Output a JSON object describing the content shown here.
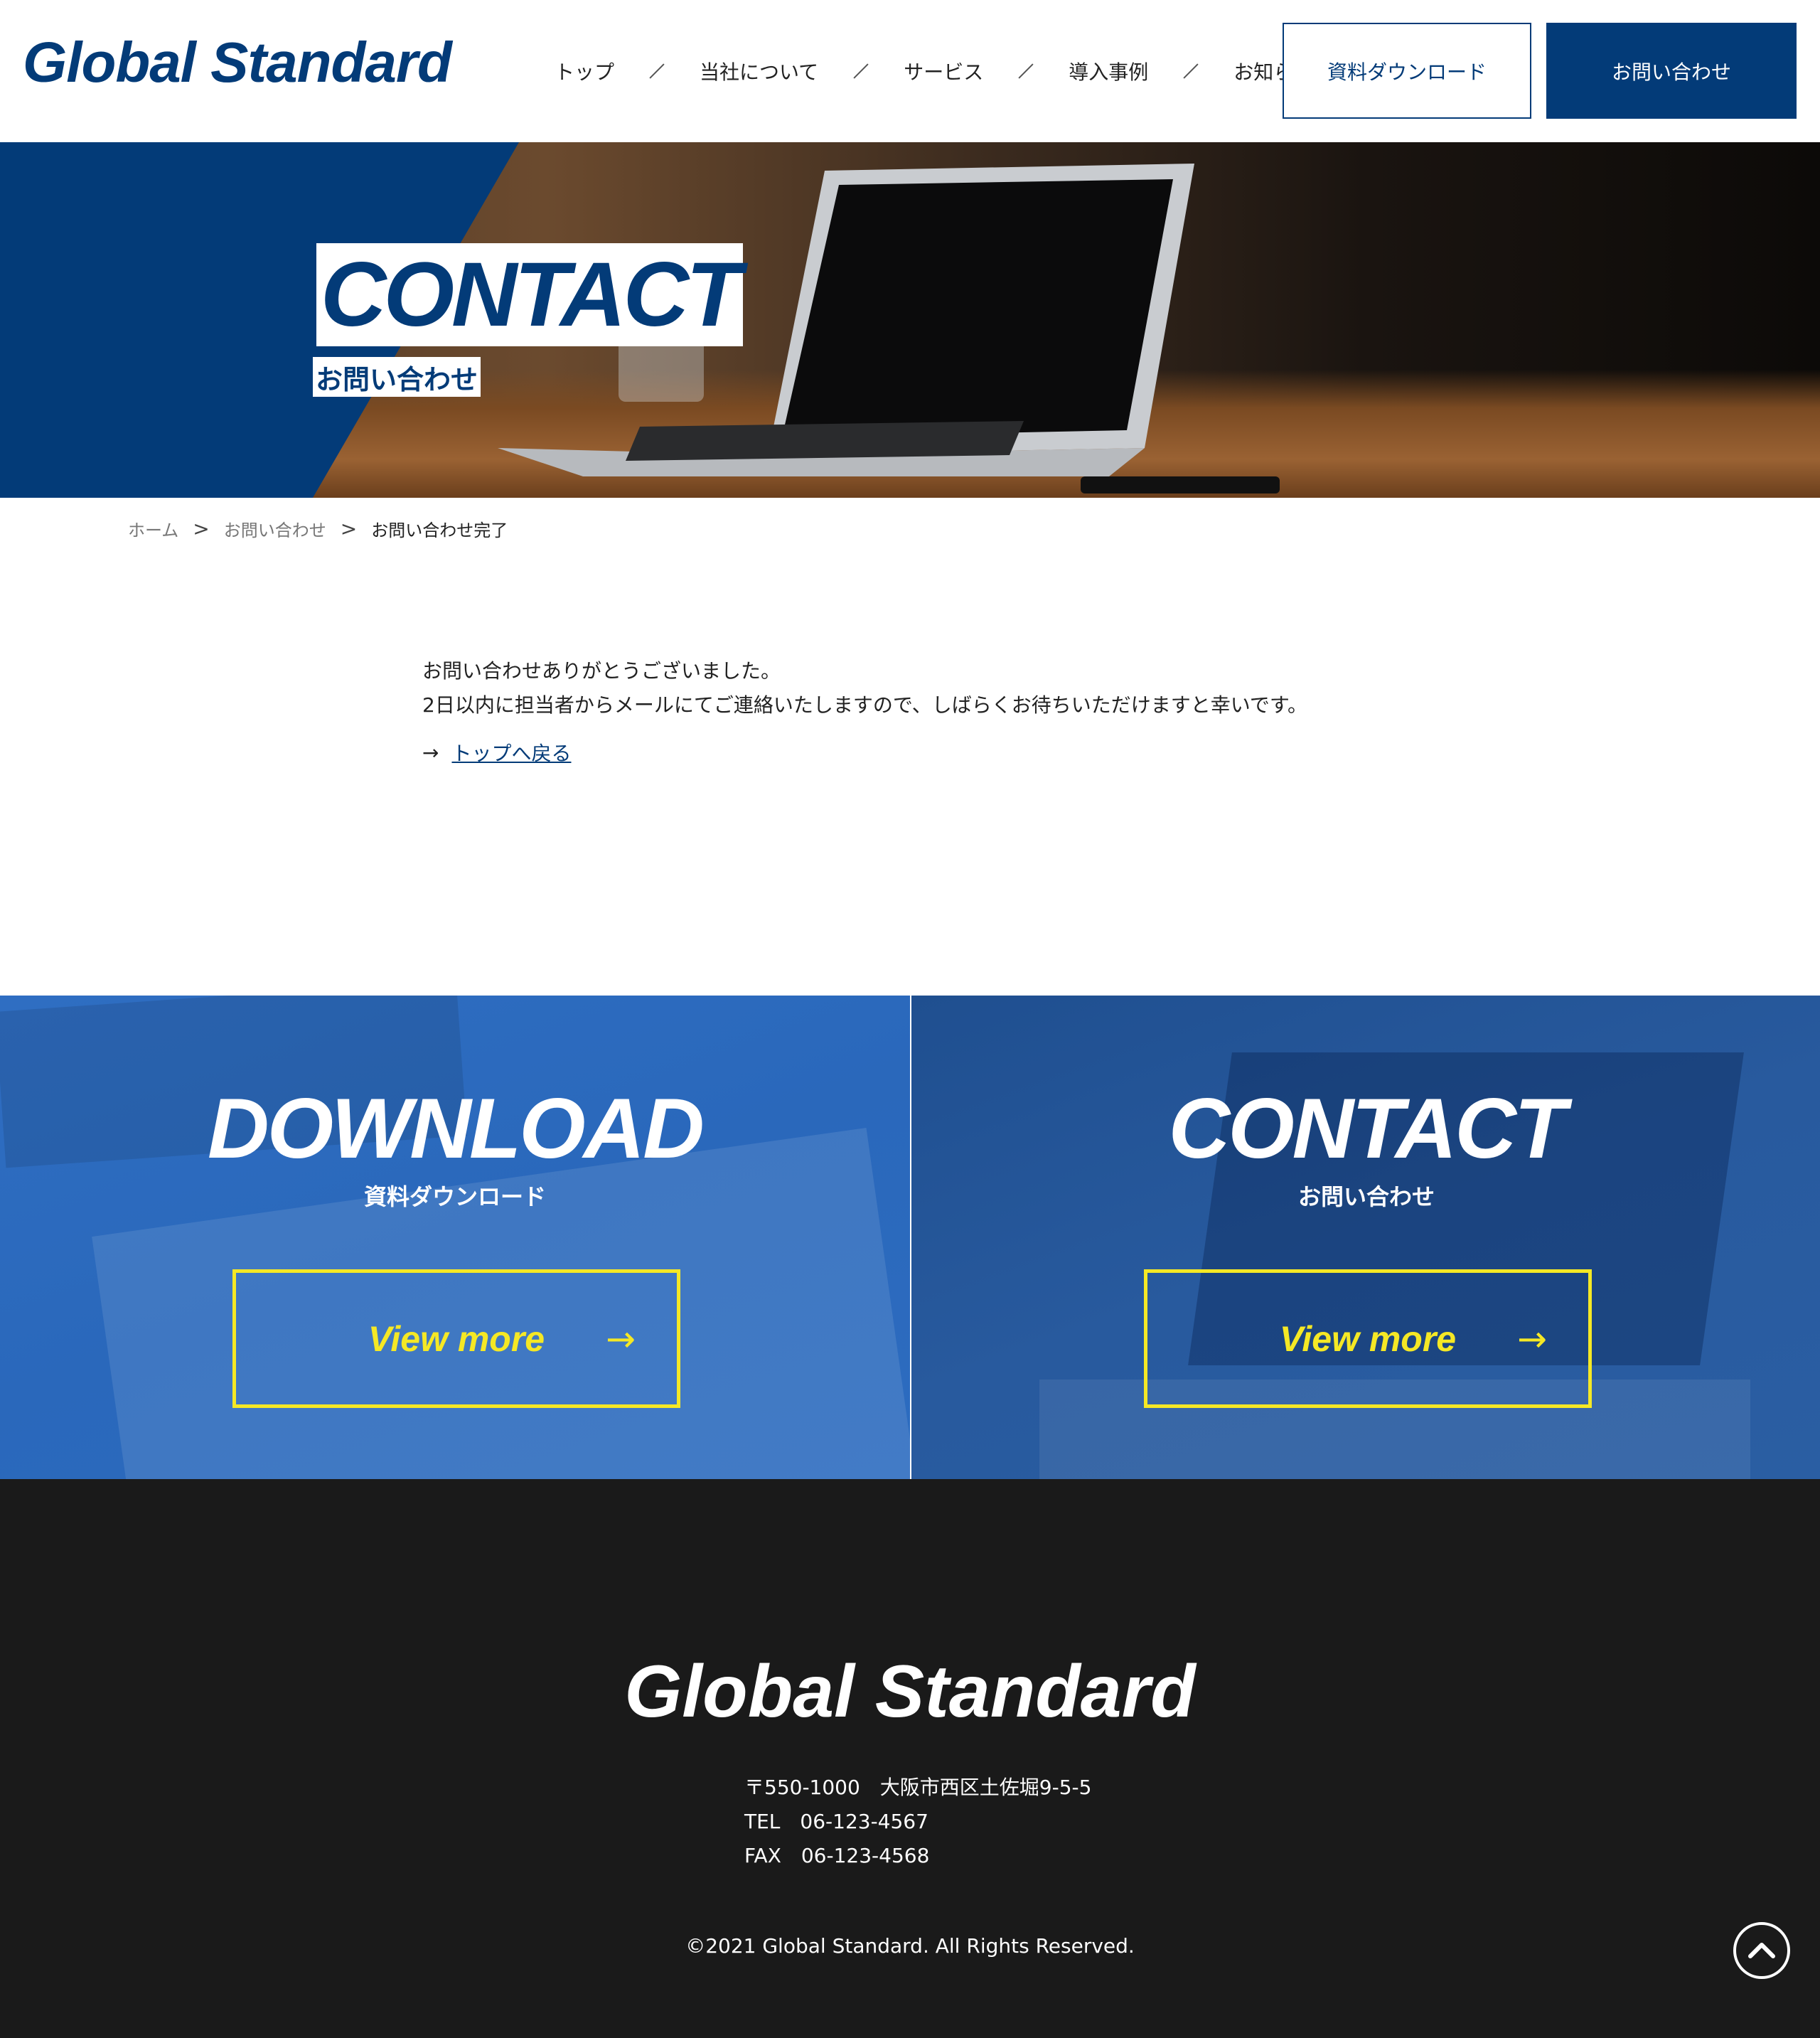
{
  "header": {
    "logo": "Global Standard",
    "nav": [
      "トップ",
      "当社について",
      "サービス",
      "導入事例",
      "お知らせ"
    ],
    "download_button": "資料ダウンロード",
    "contact_button": "お問い合わせ"
  },
  "hero": {
    "title": "CONTACT",
    "subtitle": "お問い合わせ"
  },
  "breadcrumb": {
    "items": [
      "ホーム",
      "お問い合わせ",
      "お問い合わせ完了"
    ],
    "separator": ">"
  },
  "content": {
    "line1": "お問い合わせありがとうございました。",
    "line2": "2日以内に担当者からメールにてご連絡いたしますので、しばらくお待ちいただけますと幸いです。",
    "back_arrow": "→",
    "back_link": "トップへ戻る"
  },
  "cta": {
    "download": {
      "title": "DOWNLOAD",
      "subtitle": "資料ダウンロード",
      "button": "View more",
      "arrow": "→"
    },
    "contact": {
      "title": "CONTACT",
      "subtitle": "お問い合わせ",
      "button": "View more",
      "arrow": "→"
    }
  },
  "footer": {
    "logo": "Global Standard",
    "address": "〒550-1000　大阪市西区土佐堀9-5-5",
    "tel": "TEL　06-123-4567",
    "fax": "FAX　06-123-4568",
    "copyright": "©2021 Global Standard. All Rights Reserved."
  },
  "icons": {
    "pagetop": "chevron-up-circle-icon",
    "arrow": "arrow-right-icon"
  },
  "colors": {
    "brand": "#033b78",
    "accent": "#f5e825",
    "footer_bg": "#1a1a1a"
  }
}
